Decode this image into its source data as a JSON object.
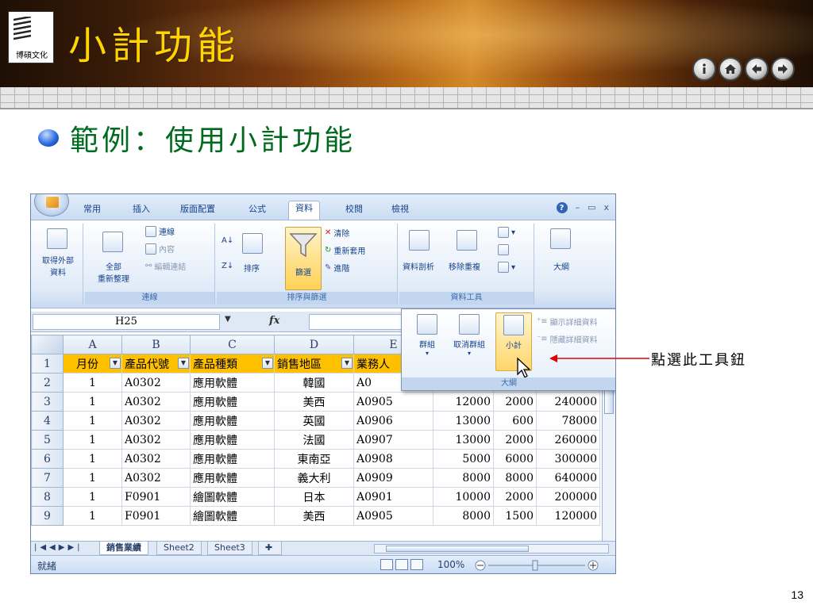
{
  "slide": {
    "title": "小計功能",
    "logo_text": "博碩文化",
    "bullet": "範例：使用小計功能",
    "annotation": "點選此工具鈕",
    "page_number": "13",
    "colors": {
      "title": "#ffd400",
      "bullet_text": "#006b1e",
      "arrow": "#e00000"
    }
  },
  "nav_buttons": [
    "info-icon",
    "home-icon",
    "back-icon",
    "forward-icon"
  ],
  "excel": {
    "tabs": [
      "常用",
      "插入",
      "版面配置",
      "公式",
      "資料",
      "校閱",
      "檢視"
    ],
    "active_tab": "資料",
    "window_controls": [
      "?",
      "–",
      "▭",
      "x"
    ],
    "ribbon": {
      "get_external": "取得外部\n資料",
      "get_external_arrow": "▾",
      "refresh_all": "全部\n重新整理",
      "connections": "連線",
      "properties": "內容",
      "edit_links": "編輯連結",
      "group_connections": "連線",
      "sort_az": "A↓Z",
      "sort_za": "Z↓A",
      "sort": "排序",
      "filter": "篩選",
      "clear": "清除",
      "reapply": "重新套用",
      "advanced": "進階",
      "group_sort_filter": "排序與篩選",
      "text_to_columns": "資料剖析",
      "remove_duplicates": "移除重複",
      "group_data_tools": "資料工具",
      "outline": "大綱"
    },
    "outline_panel": {
      "group": "群組",
      "ungroup": "取消群組",
      "subtotal": "小計",
      "show_detail": "顯示詳細資料",
      "hide_detail": "隱藏詳細資料",
      "label": "大綱"
    },
    "name_box": "H25",
    "fx": "fx",
    "columns": [
      "A",
      "B",
      "C",
      "D",
      "E"
    ],
    "header_row": [
      "月份",
      "產品代號",
      "產品種類",
      "銷售地區",
      "業務人"
    ],
    "rows": [
      {
        "n": "2",
        "a": "1",
        "b": "A0302",
        "c": "應用軟體",
        "d": "韓國",
        "e": "A0",
        "f": "",
        "g": "",
        "h": ""
      },
      {
        "n": "3",
        "a": "1",
        "b": "A0302",
        "c": "應用軟體",
        "d": "美西",
        "e": "A0905",
        "f": "12000",
        "g": "2000",
        "h": "240000"
      },
      {
        "n": "4",
        "a": "1",
        "b": "A0302",
        "c": "應用軟體",
        "d": "英國",
        "e": "A0906",
        "f": "13000",
        "g": "600",
        "h": "78000"
      },
      {
        "n": "5",
        "a": "1",
        "b": "A0302",
        "c": "應用軟體",
        "d": "法國",
        "e": "A0907",
        "f": "13000",
        "g": "2000",
        "h": "260000"
      },
      {
        "n": "6",
        "a": "1",
        "b": "A0302",
        "c": "應用軟體",
        "d": "東南亞",
        "e": "A0908",
        "f": "5000",
        "g": "6000",
        "h": "300000"
      },
      {
        "n": "7",
        "a": "1",
        "b": "A0302",
        "c": "應用軟體",
        "d": "義大利",
        "e": "A0909",
        "f": "8000",
        "g": "8000",
        "h": "640000"
      },
      {
        "n": "8",
        "a": "1",
        "b": "F0901",
        "c": "繪圖軟體",
        "d": "日本",
        "e": "A0901",
        "f": "10000",
        "g": "2000",
        "h": "200000"
      },
      {
        "n": "9",
        "a": "1",
        "b": "F0901",
        "c": "繪圖軟體",
        "d": "美西",
        "e": "A0905",
        "f": "8000",
        "g": "1500",
        "h": "120000"
      }
    ],
    "sheet_tabs": [
      "銷售業績",
      "Sheet2",
      "Sheet3"
    ],
    "active_sheet": "銷售業績",
    "status": "就緒",
    "zoom": "100%"
  }
}
